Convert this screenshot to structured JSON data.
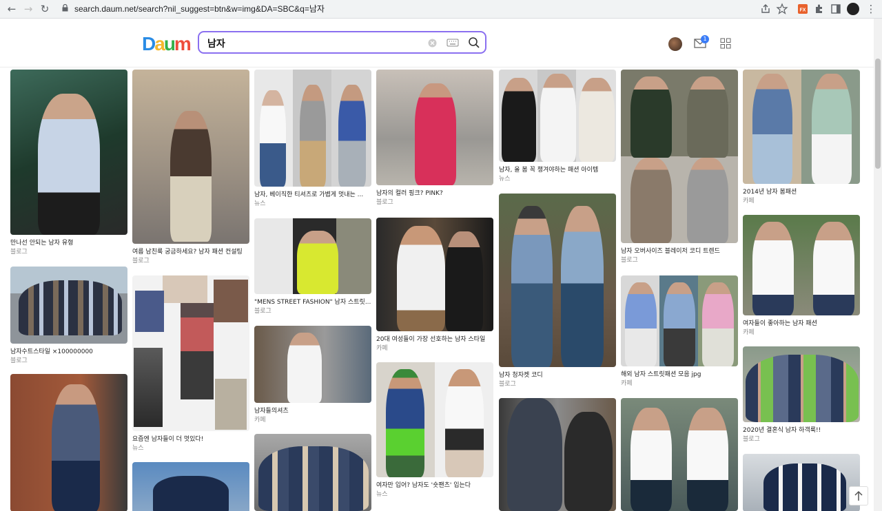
{
  "browser": {
    "url": "search.daum.net/search?nil_suggest=btn&w=img&DA=SBC&q=남자"
  },
  "header": {
    "logo": "Daum",
    "search_value": "남자",
    "mail_badge": "1"
  },
  "cards": [
    {
      "caption": "만나선 안되는 남자 유형",
      "source": "블로그"
    },
    {
      "caption": "남자수트스타일 ×100000000",
      "source": "블로그"
    },
    {
      "caption": "",
      "source": ""
    },
    {
      "caption": "여름 남친룩 궁금하세요? 남자 패션 컨설팅",
      "source": "블로그"
    },
    {
      "caption": "요즘엔 남자들이 더 멋있다!",
      "source": "뉴스"
    },
    {
      "caption": "",
      "source": ""
    },
    {
      "caption": "남자, 베이직한 티셔츠로 가볍게 멋내는 ...",
      "source": "뉴스"
    },
    {
      "caption": "\"MENS STREET FASHION\" 남자 스트릿...",
      "source": "블로그"
    },
    {
      "caption": "남자들의셔츠",
      "source": "카페"
    },
    {
      "caption": "",
      "source": ""
    },
    {
      "caption": "남자의 컬러 핑크? PINK?",
      "source": "블로그"
    },
    {
      "caption": "20대 여성들이 가장 선호하는 남자 스타일",
      "source": "카페"
    },
    {
      "caption": "여자만 입어? 남자도 '숏팬츠' 입는다",
      "source": "뉴스"
    },
    {
      "caption": "남자, 올 봄 꼭 챙겨야하는 패션 아이템",
      "source": "뉴스"
    },
    {
      "caption": "남자 청자켓 코디",
      "source": "블로그"
    },
    {
      "caption": "",
      "source": ""
    },
    {
      "caption": "남자 오버사이즈 블레이저 코디 트렌드",
      "source": "블로그"
    },
    {
      "caption": "해외 남자 스트릿패션 모음 jpg",
      "source": "카페"
    },
    {
      "caption": "",
      "source": ""
    },
    {
      "caption": "2014년 남자 봄패션",
      "source": "카페"
    },
    {
      "caption": "여자들이 좋아하는 남자 패션",
      "source": "카페"
    },
    {
      "caption": "2020년 결혼식 남자 하객룩!!",
      "source": "블로그"
    },
    {
      "caption": "",
      "source": ""
    }
  ]
}
